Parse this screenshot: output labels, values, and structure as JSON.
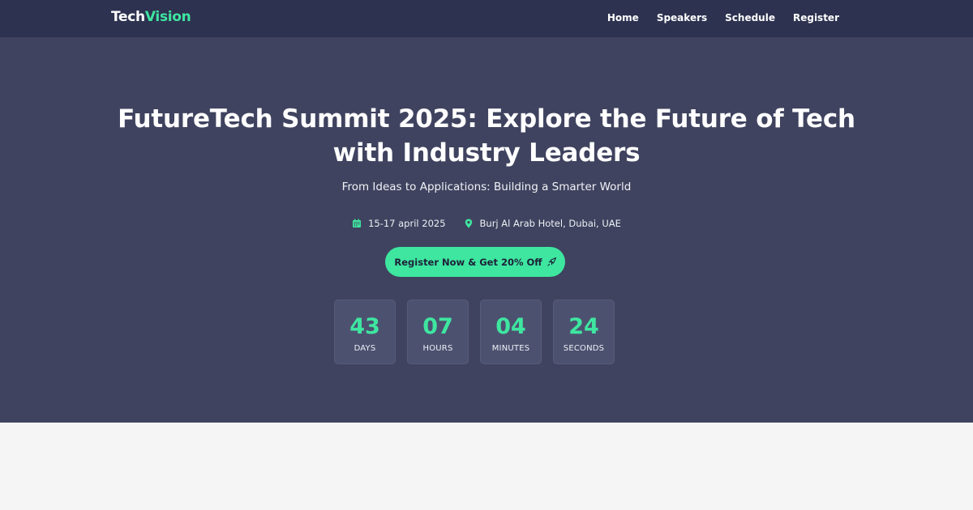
{
  "brand": {
    "name_part1": "Tech",
    "name_part2": "Vision",
    "accent_color": "#3ee6a0"
  },
  "nav": {
    "items": [
      {
        "label": "Home"
      },
      {
        "label": "Speakers"
      },
      {
        "label": "Schedule"
      },
      {
        "label": "Register"
      }
    ]
  },
  "hero": {
    "title_line1": "FutureTech Summit 2025: Explore the Future of Tech",
    "title_line2": "with Industry Leaders",
    "subtitle": "From Ideas to Applications: Building a Smarter World",
    "date": {
      "icon": "calendar-icon",
      "text": "15-17 april 2025"
    },
    "location": {
      "icon": "map-pin-icon",
      "text": "Burj Al Arab Hotel, Dubai, UAE"
    },
    "cta": {
      "label": "Register Now & Get 20% Off",
      "icon": "rocket-icon"
    }
  },
  "countdown": [
    {
      "value": "43",
      "label": "DAYS"
    },
    {
      "value": "07",
      "label": "HOURS"
    },
    {
      "value": "04",
      "label": "MINUTES"
    },
    {
      "value": "24",
      "label": "SECONDS"
    }
  ],
  "colors": {
    "navbar_bg": "#2d3250",
    "hero_bg": "#3f435f",
    "accent": "#3ee6a0",
    "page_bg": "#f5f5f5"
  }
}
